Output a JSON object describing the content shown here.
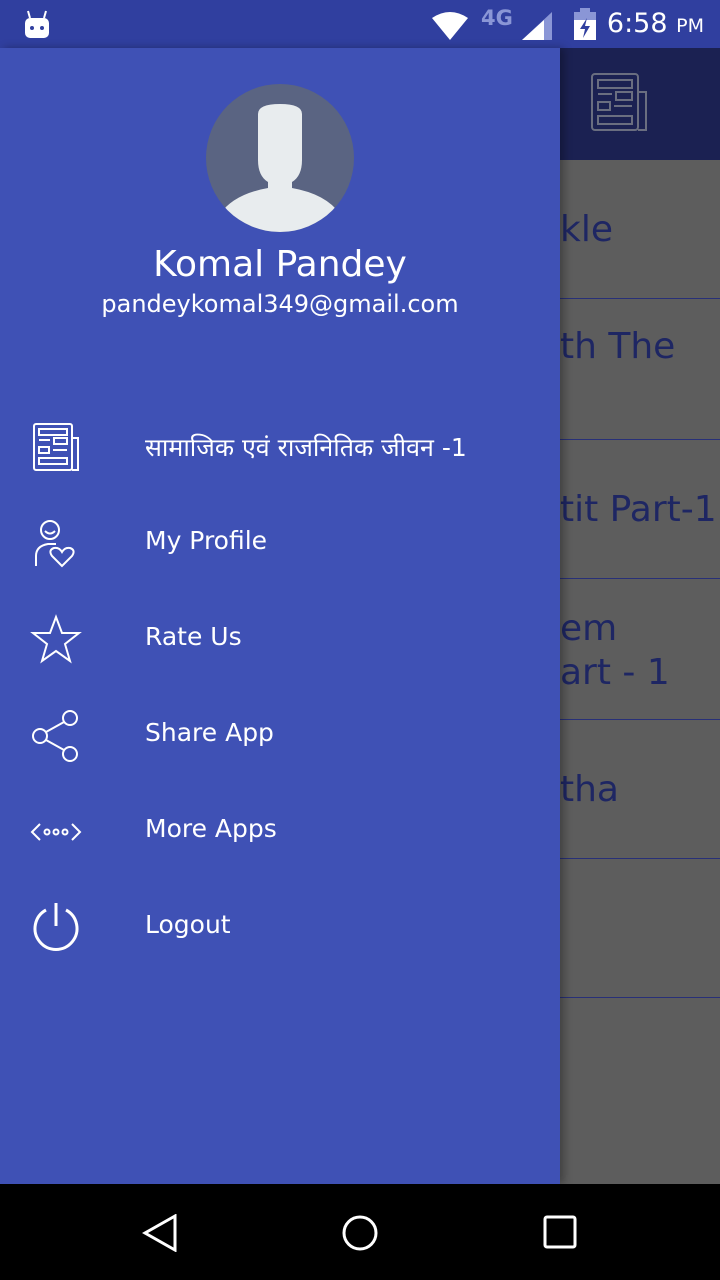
{
  "status_bar": {
    "network": "4G",
    "time": "6:58",
    "ampm": "PM"
  },
  "background": {
    "rows": [
      "kle",
      "th The",
      "tit Part-1",
      "em\nart - 1",
      "tha",
      ""
    ]
  },
  "drawer": {
    "user_name": "Komal Pandey",
    "user_email": "pandeykomal349@gmail.com",
    "items": [
      {
        "label": "सामाजिक एवं राजनितिक जीवन -1",
        "icon": "newspaper-icon"
      },
      {
        "label": "My Profile",
        "icon": "profile-heart-icon"
      },
      {
        "label": "Rate Us",
        "icon": "star-icon"
      },
      {
        "label": "Share App",
        "icon": "share-icon"
      },
      {
        "label": "More Apps",
        "icon": "code-dots-icon"
      },
      {
        "label": "Logout",
        "icon": "power-icon"
      }
    ]
  },
  "colors": {
    "drawer": "#3f51b5",
    "status": "#303f9f",
    "toolbar": "#1b2152"
  }
}
